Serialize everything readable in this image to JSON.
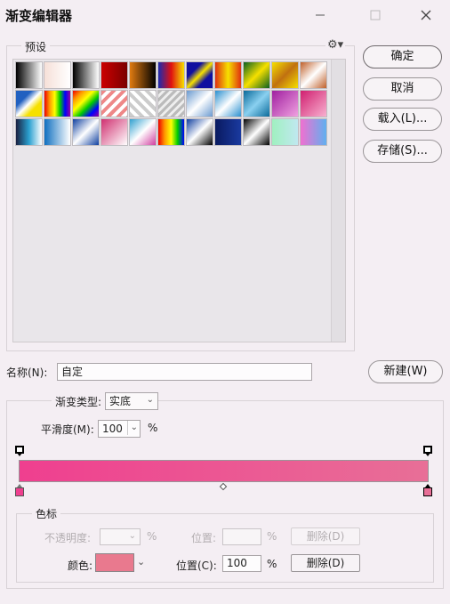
{
  "window": {
    "title": "渐变编辑器"
  },
  "presets": {
    "label": "预设",
    "gear_icon": "gear-icon",
    "swatches": [
      "linear-gradient(90deg,#000,#fff)",
      "linear-gradient(90deg,#f6e0d8,#fff)",
      "linear-gradient(90deg,#000,#fff)",
      "linear-gradient(90deg,#c00,#7a0000)",
      "linear-gradient(90deg,#e07a10,#000)",
      "linear-gradient(90deg,#1a2ab0,#e01010,#f6e000)",
      "linear-gradient(135deg,#1010a0 30%,#f6e000 50%,#1010a0 70%)",
      "linear-gradient(90deg,#e03010,#f6e000,#e03010)",
      "linear-gradient(135deg,#0a6020,#f6e000,#0a6020)",
      "linear-gradient(135deg,#f6e000,#c07010,#f6e000)",
      "linear-gradient(135deg,#c0602a,#fff,#c0602a)",
      "linear-gradient(135deg,#2060c0 30%,#fff 50%,#f6e000 70%)",
      "linear-gradient(90deg,#e00,#f90,#ff0,#0c0,#00f,#909)",
      "linear-gradient(135deg,#e00,#f90,#ff0,#0c0,#00f,#909)",
      "repeating-linear-gradient(135deg,#e88 0 4px,#fff 4px 8px)",
      "repeating-linear-gradient(45deg,#ccc 0 4px,#fff 4px 8px)",
      "repeating-linear-gradient(135deg,#bbb 0 3px,#eee 3px 6px)",
      "linear-gradient(135deg,#6a9ad0,#fff,#6a9ad0)",
      "linear-gradient(135deg,#2a90d0,#fff,#2a90d0)",
      "linear-gradient(135deg,#0a6a9a,#8ad0f0,#0a6a9a)",
      "linear-gradient(135deg,#a020a0,#f0a0e0)",
      "linear-gradient(135deg,#d02070,#f8b0d0)",
      "linear-gradient(90deg,#1a2040,#2aa0d0,#fff)",
      "linear-gradient(90deg,#1070c0,#fff)",
      "linear-gradient(135deg,#1040a0,#fff,#1040a0)",
      "linear-gradient(135deg,#d03070,#fff)",
      "linear-gradient(135deg,#30a0d0,#fff,#d040a0)",
      "linear-gradient(90deg,#e00,#f90,#ff0,#0c0,#00f)",
      "linear-gradient(135deg,#1040a0,#fff,#000)",
      "linear-gradient(90deg,#0a1a60,#1a3aa0)",
      "linear-gradient(135deg,#000,#fff,#000)",
      "linear-gradient(90deg,#a0f0c0,#c0e8f0)",
      "linear-gradient(90deg,#f070d0,#60b0f0)"
    ]
  },
  "buttons": {
    "ok": "确定",
    "cancel": "取消",
    "load": "载入(L)...",
    "save": "存储(S)...",
    "new": "新建(W)"
  },
  "name": {
    "label": "名称(N):",
    "value": "自定"
  },
  "gradient": {
    "type_label": "渐变类型:",
    "type_value": "实底",
    "smooth_label": "平滑度(M):",
    "smooth_value": "100",
    "smooth_unit": "%",
    "colors": {
      "start": "#ef3f8f",
      "end": "#e86f97"
    }
  },
  "stops": {
    "label": "色标",
    "opacity_label": "不透明度:",
    "opacity_unit": "%",
    "opacity_location_label": "位置:",
    "opacity_location_unit": "%",
    "opacity_delete": "删除(D)",
    "color_label": "颜色:",
    "color_value": "#e9798e",
    "color_location_label": "位置(C):",
    "color_location_value": "100",
    "color_location_unit": "%",
    "color_delete": "删除(D)"
  }
}
